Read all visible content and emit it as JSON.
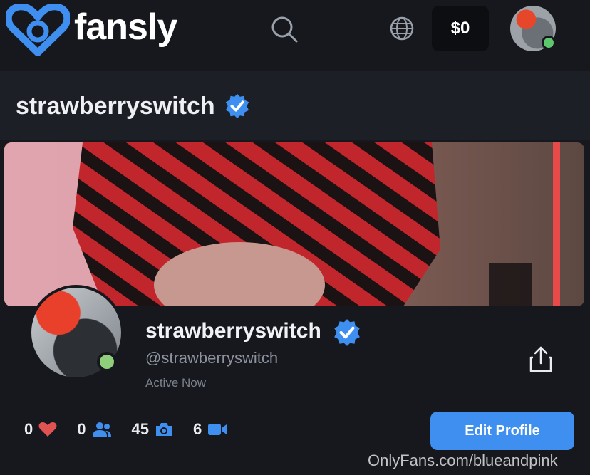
{
  "header": {
    "brand": "fansly",
    "balance": "$0"
  },
  "page": {
    "title": "strawberryswitch"
  },
  "profile": {
    "display_name": "strawberryswitch",
    "handle": "@strawberryswitch",
    "status": "Active Now",
    "stats": {
      "likes": "0",
      "subscribers": "0",
      "photos": "45",
      "videos": "6"
    },
    "edit_label": "Edit Profile"
  },
  "watermark": "OnlyFans.com/blueandpink",
  "colors": {
    "accent": "#3f8ff0",
    "verified": "#3f8ff0",
    "online": "#5fc76e",
    "heart": "#e05353",
    "background": "#16181d"
  }
}
